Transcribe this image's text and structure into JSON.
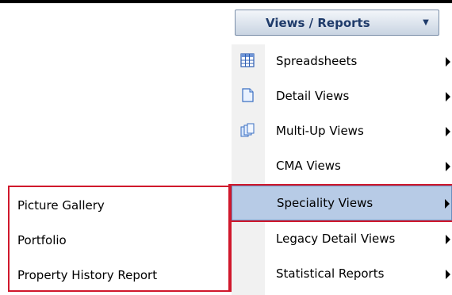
{
  "dropdown": {
    "label": "Views / Reports"
  },
  "menu": {
    "items": [
      {
        "label": "Spreadsheets",
        "icon": "spreadsheet-icon"
      },
      {
        "label": "Detail Views",
        "icon": "document-icon"
      },
      {
        "label": "Multi-Up Views",
        "icon": "multi-document-icon"
      },
      {
        "label": "CMA Views",
        "icon": ""
      },
      {
        "label": "Speciality Views",
        "icon": "",
        "selected": true
      },
      {
        "label": "Legacy Detail Views",
        "icon": ""
      },
      {
        "label": "Statistical Reports",
        "icon": ""
      }
    ]
  },
  "submenu": {
    "items": [
      {
        "label": "Picture Gallery"
      },
      {
        "label": "Portfolio"
      },
      {
        "label": "Property History Report"
      }
    ]
  },
  "colors": {
    "highlight": "#b7cbe6",
    "annotation": "#d0182c",
    "button_text": "#1f3b6a"
  }
}
